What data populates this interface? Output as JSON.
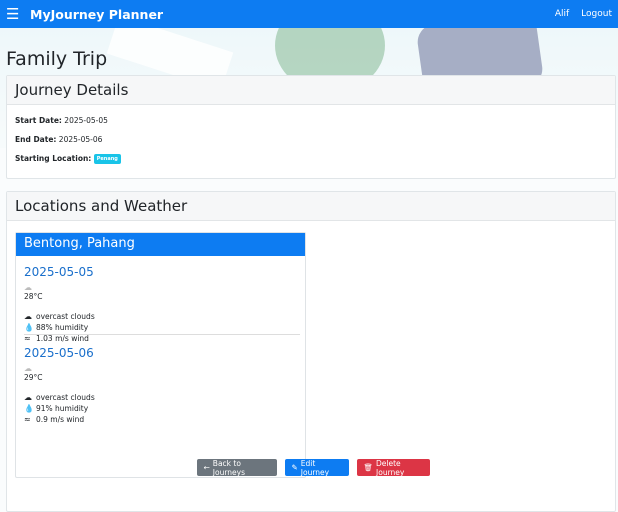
{
  "navbar": {
    "brand": "MyJourney Planner",
    "menu_icon": "hamburger-menu-icon",
    "user": "Alif",
    "logout": "Logout"
  },
  "page": {
    "title": "Family Trip"
  },
  "journey_details": {
    "header": "Journey Details",
    "start_label": "Start Date:",
    "start_value": "2025-05-05",
    "end_label": "End Date:",
    "end_value": "2025-05-06",
    "location_label": "Starting Location:",
    "location_value": "Penang"
  },
  "weather": {
    "header": "Locations and Weather",
    "location": "Bentong, Pahang",
    "days": [
      {
        "date": "2025-05-05",
        "temp": "28°C",
        "condition": "overcast clouds",
        "humidity": "88% humidity",
        "wind": "1.03 m/s wind"
      },
      {
        "date": "2025-05-06",
        "temp": "29°C",
        "condition": "overcast clouds",
        "humidity": "91% humidity",
        "wind": "0.9 m/s wind"
      }
    ]
  },
  "buttons": {
    "back": "Back to Journeys",
    "edit": "Edit Journey",
    "delete": "Delete Journey"
  },
  "colors": {
    "primary": "#0d7cf2",
    "danger": "#dc3545",
    "secondary": "#6c757d",
    "badge": "#19c4e8"
  }
}
